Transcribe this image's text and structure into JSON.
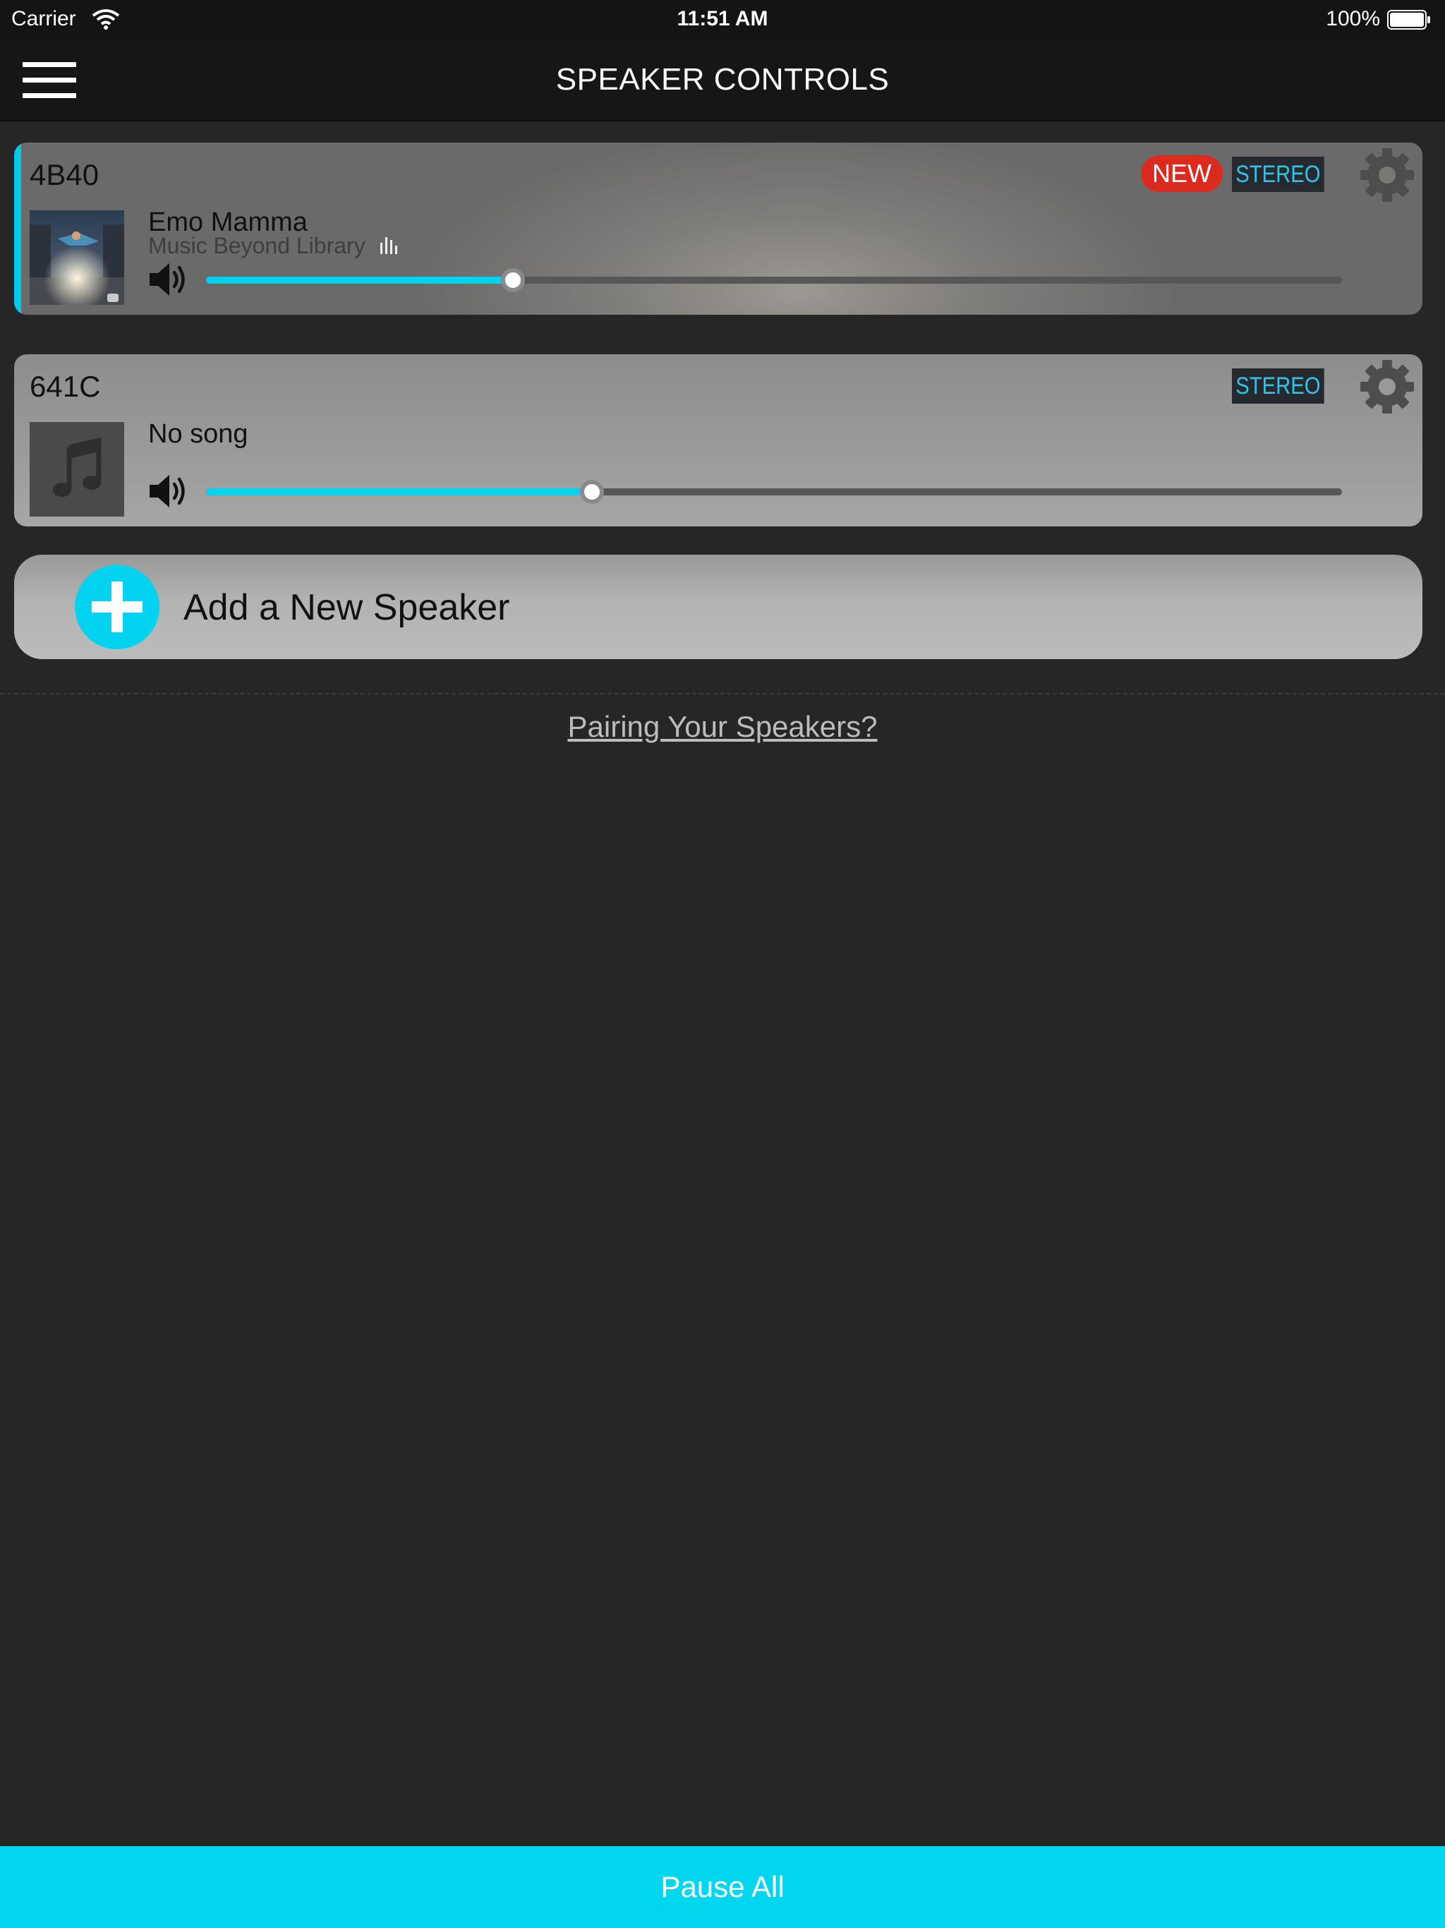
{
  "status_bar": {
    "carrier": "Carrier",
    "time": "11:51 AM",
    "battery": "100%"
  },
  "nav": {
    "title": "SPEAKER CONTROLS",
    "menu_icon": "hamburger-menu-icon"
  },
  "speakers": [
    {
      "name": "4B40",
      "new_badge": "NEW",
      "mode_badge": "STEREO",
      "song": "Emo Mamma",
      "source": "Music Beyond Library",
      "volume": 0.27,
      "active": true
    },
    {
      "name": "641C",
      "mode_badge": "STEREO",
      "song": "No song",
      "volume": 0.34,
      "active": false
    }
  ],
  "add_speaker": {
    "label": "Add a New Speaker"
  },
  "pairing_link": "Pairing Your Speakers?",
  "pause_all": "Pause All",
  "colors": {
    "accent": "#00d2f0",
    "new_badge": "#dd2a1e",
    "stereo_text": "#2fc4ea",
    "background": "#262626"
  }
}
